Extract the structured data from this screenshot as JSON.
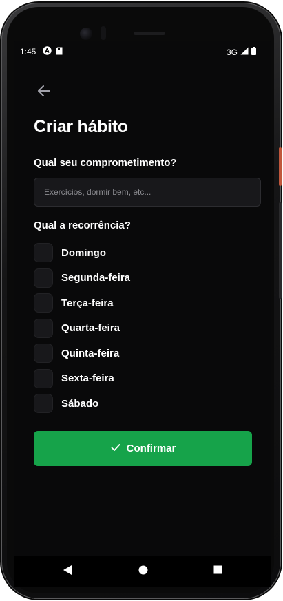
{
  "status_bar": {
    "time": "1:45",
    "network": "3G",
    "left_icons": [
      "app-notification-icon",
      "sd-card-icon"
    ],
    "right_icons": [
      "signal-icon",
      "battery-icon"
    ]
  },
  "header": {
    "back_icon": "arrow-left-icon",
    "title": "Criar hábito"
  },
  "form": {
    "commitment_label": "Qual seu comprometimento?",
    "commitment_value": "",
    "commitment_placeholder": "Exercícios, dormir bem, etc...",
    "recurrence_label": "Qual a recorrência?",
    "days": [
      {
        "label": "Domingo",
        "checked": false
      },
      {
        "label": "Segunda-feira",
        "checked": false
      },
      {
        "label": "Terça-feira",
        "checked": false
      },
      {
        "label": "Quarta-feira",
        "checked": false
      },
      {
        "label": "Quinta-feira",
        "checked": false
      },
      {
        "label": "Sexta-feira",
        "checked": false
      },
      {
        "label": "Sábado",
        "checked": false
      }
    ],
    "confirm_label": "Confirmar",
    "confirm_icon": "check-icon"
  },
  "nav_bar": {
    "items": [
      "back-triangle-icon",
      "home-circle-icon",
      "recents-square-icon"
    ]
  },
  "colors": {
    "background": "#09090a",
    "surface": "#18181b",
    "accent": "#16a34a",
    "text": "#ffffff",
    "placeholder": "#8b8b90"
  }
}
